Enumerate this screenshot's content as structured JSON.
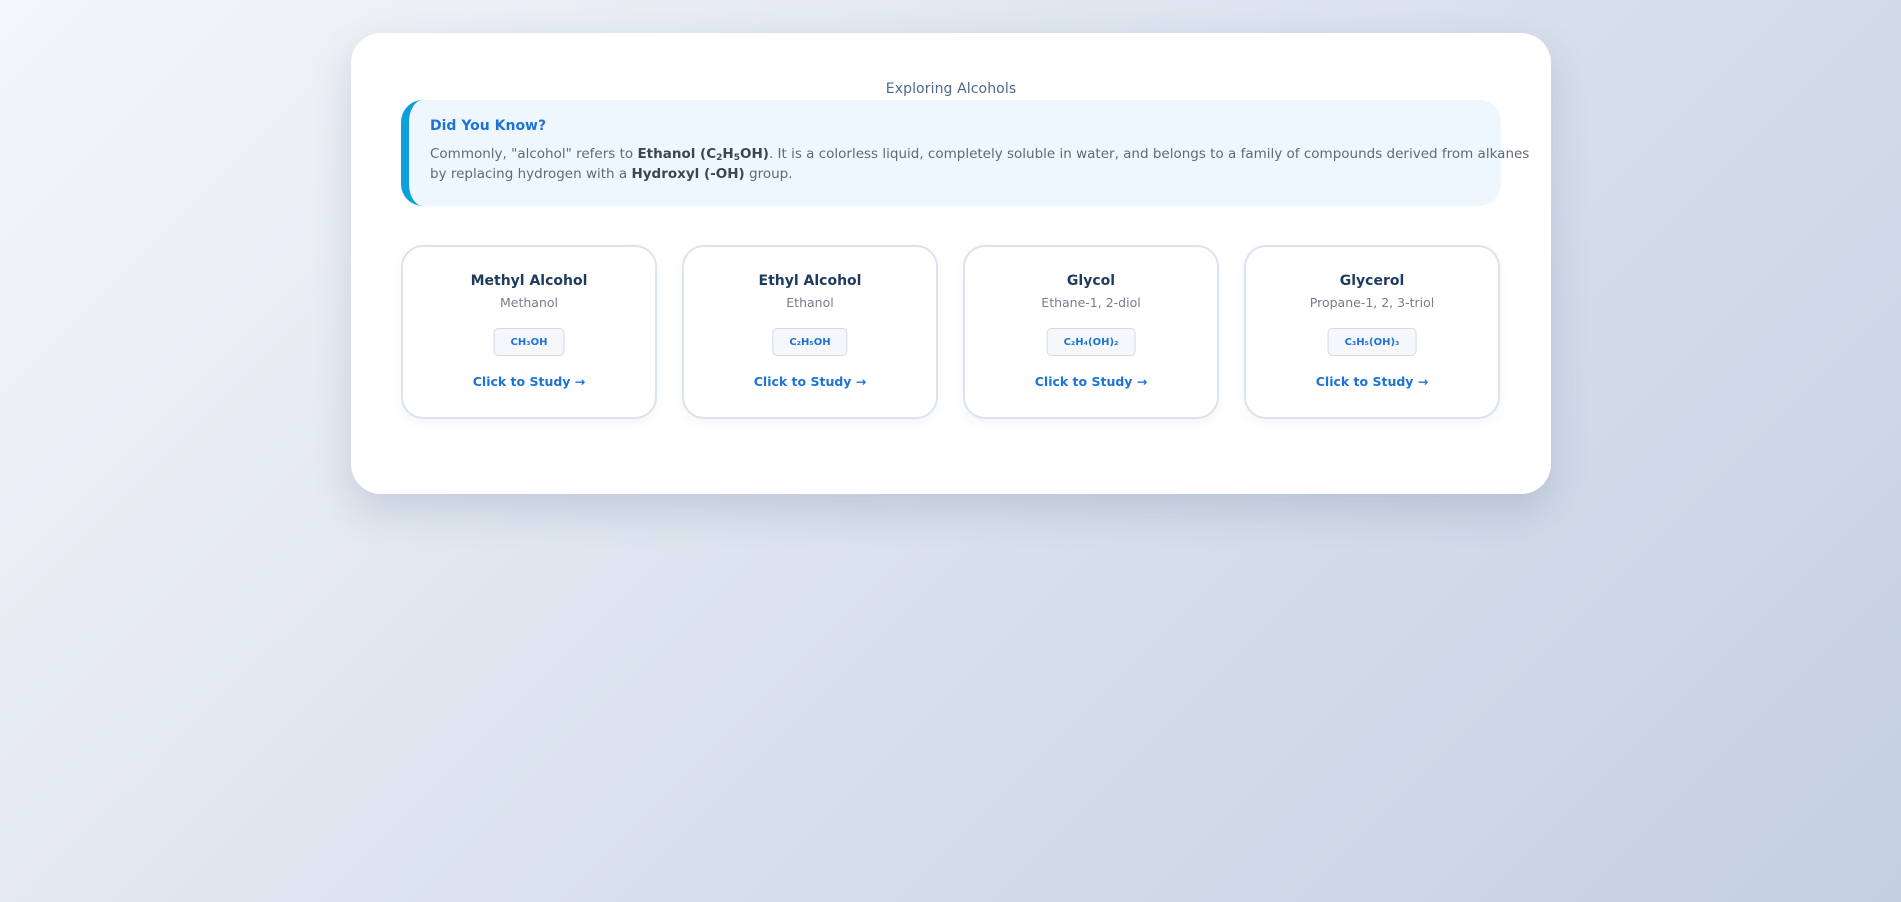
{
  "page": {
    "title": "Exploring Alcohols"
  },
  "info": {
    "heading": "Did You Know?",
    "line1_pre": "Commonly, \"alcohol\" refers to ",
    "ethanol_name": "Ethanol (C",
    "ethanol_sub1": "2",
    "ethanol_mid": "H",
    "ethanol_sub2": "5",
    "ethanol_end": "OH)",
    "line1_post": ". It is a colorless liquid, completely soluble in water, and belongs to a family of compounds derived from alkanes",
    "line2_pre": "by replacing hydrogen with a ",
    "hydroxyl": "Hydroxyl (-OH)",
    "line2_post": " group."
  },
  "cards": [
    {
      "name": "Methyl Alcohol",
      "iupac": "Methanol",
      "formula": "CH₃OH",
      "link": "Click to Study →"
    },
    {
      "name": "Ethyl Alcohol",
      "iupac": "Ethanol",
      "formula": "C₂H₅OH",
      "link": "Click to Study →"
    },
    {
      "name": "Glycol",
      "iupac": "Ethane-1, 2-diol",
      "formula": "C₂H₄(OH)₂",
      "link": "Click to Study →"
    },
    {
      "name": "Glycerol",
      "iupac": "Propane-1, 2, 3-triol",
      "formula": "C₃H₅(OH)₃",
      "link": "Click to Study →"
    }
  ],
  "colors": {
    "accent": "#1d73d6",
    "info_border": "#0ea0dc",
    "info_background": "#eff7fe",
    "card_title": "#1c3b5e"
  }
}
